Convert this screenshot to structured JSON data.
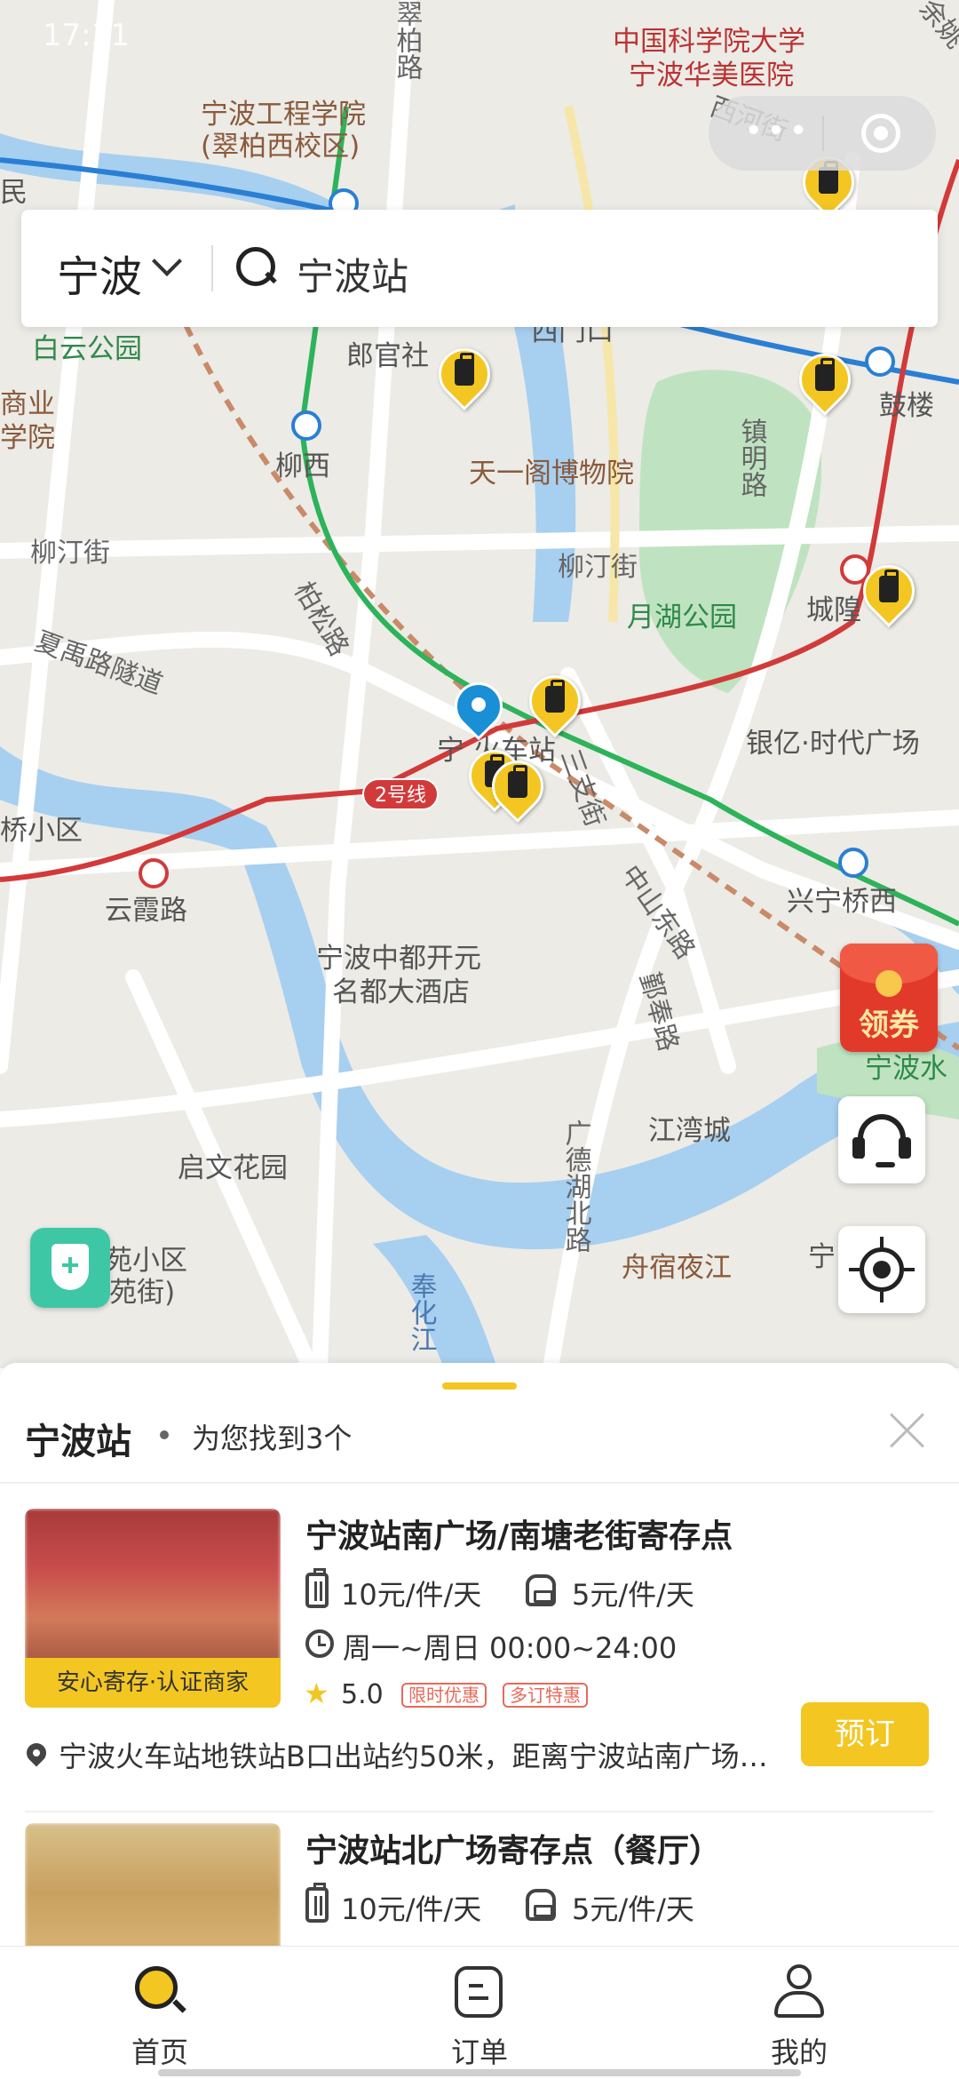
{
  "status": {
    "time": "17:31"
  },
  "search": {
    "city": "宁波",
    "query": "宁波站"
  },
  "map": {
    "labels": {
      "l1": "宁波工程学院",
      "l2": "(翠柏西校区)",
      "l3": "中国科学院大学",
      "l4": "宁波华美医院",
      "l5": "西河街",
      "l6": "白云公园",
      "l7": "郎官社",
      "l8": "西门口",
      "l9": "鼓楼",
      "l10": "商业",
      "l11": "学院",
      "l12": "柳西",
      "l13": "天一阁博物院",
      "l14": "镇明路",
      "l15": "柳汀街",
      "l16": "柳汀街",
      "l17": "月湖公园",
      "l18": "城隍",
      "l19": "夏禹路隧道",
      "l20": "柏松路",
      "l21": "宁 火车站",
      "l22": "银亿·时代广场",
      "l23": "桥小区",
      "l24": "三支街",
      "l25": "云霞路",
      "l26": "兴宁桥西",
      "l27": "宁波中都开元",
      "l28": "名都大酒店",
      "l29": "中山东路",
      "l30": "鄞奉路",
      "l31": "宁波水",
      "l32": "江湾城",
      "l33": "启文花园",
      "l34": "广德湖北路",
      "l35": "苑小区",
      "l36": "(南苑街)",
      "l37": "舟宿夜江",
      "l38": "奉化江",
      "l39": "翠柏路",
      "l40": "民",
      "l41": "宁",
      "l42": "余姚"
    },
    "metro_line_badge": "2号线"
  },
  "floating": {
    "coupon_label": "领券"
  },
  "panel": {
    "title": "宁波站",
    "count_text": "为您找到3个",
    "results": [
      {
        "name": "宁波站南广场/南塘老街寄存点",
        "tag": "安心寄存·认证商家",
        "price_luggage": "10元/件/天",
        "price_bag": "5元/件/天",
        "hours": "周一~周日 00:00~24:00",
        "rating": "5.0",
        "badges": [
          "限时优惠",
          "多订特惠"
        ],
        "address": "宁波火车站地铁站B口出站约50米，距离宁波站南广场…",
        "book_label": "预订"
      },
      {
        "name": "宁波站北广场寄存点（餐厅）",
        "price_luggage": "10元/件/天",
        "price_bag": "5元/件/天"
      }
    ]
  },
  "tabbar": {
    "tabs": [
      {
        "label": "首页"
      },
      {
        "label": "订单"
      },
      {
        "label": "我的"
      }
    ]
  },
  "colors": {
    "accent": "#f3c622",
    "metro_red": "#d23a3a",
    "metro_green": "#2db35a",
    "metro_blue": "#2a7fd4",
    "user_pin": "#1a8fd6"
  }
}
